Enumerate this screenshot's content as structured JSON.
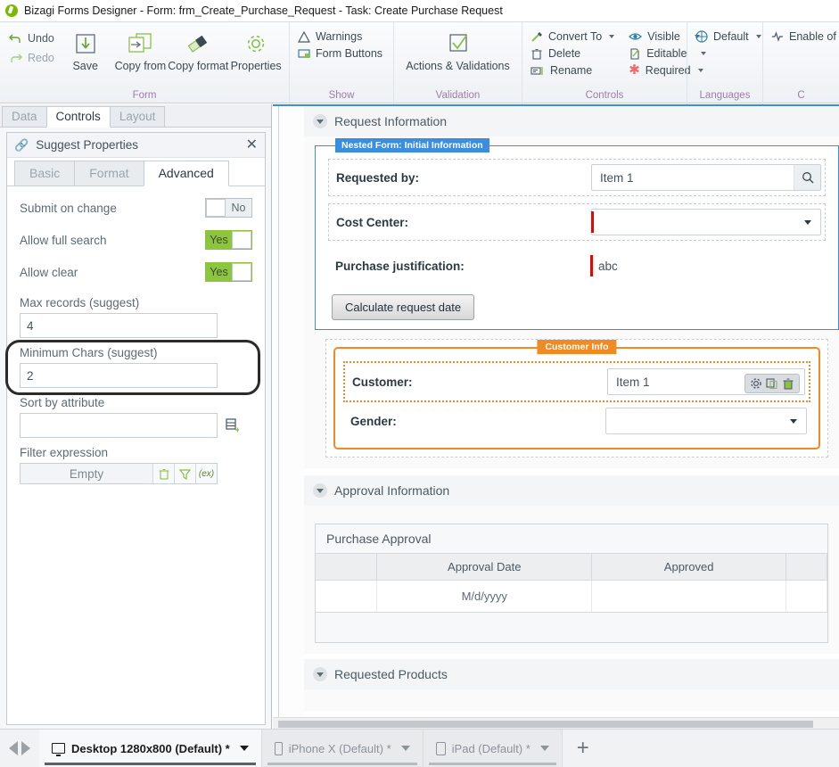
{
  "titlebar": {
    "app_name": "Bizagi Forms Designer",
    "full_title": "Bizagi Forms Designer  - Form: frm_Create_Purchase_Request - Task:  Create Purchase Request"
  },
  "ribbon": {
    "groups": [
      {
        "title": "Form",
        "small_commands": [
          {
            "label": "Undo",
            "icon": "undo-icon",
            "enabled": true
          },
          {
            "label": "Redo",
            "icon": "redo-icon",
            "enabled": false
          }
        ],
        "buttons": [
          {
            "label": "Save",
            "icon": "save-icon"
          },
          {
            "label": "Copy from",
            "icon": "copy-from-icon"
          },
          {
            "label": "Copy format",
            "icon": "copy-format-icon"
          },
          {
            "label": "Properties",
            "icon": "gear-icon"
          }
        ]
      },
      {
        "title": "Show",
        "items": [
          {
            "label": "Warnings",
            "icon": "warning-icon"
          },
          {
            "label": "Form Buttons",
            "icon": "form-buttons-icon"
          }
        ]
      },
      {
        "title": "Validation",
        "buttons": [
          {
            "label": "Actions & Validations",
            "icon": "checkmark-box-icon"
          }
        ]
      },
      {
        "title": "Controls",
        "items": [
          {
            "label": "Convert To",
            "icon": "convert-to-icon",
            "caret": true
          },
          {
            "label": "Delete",
            "icon": "trash-icon",
            "caret": false
          },
          {
            "label": "Rename",
            "icon": "rename-icon",
            "caret": false
          }
        ],
        "items2": [
          {
            "label": "Visible",
            "icon": "eye-icon",
            "caret": true
          },
          {
            "label": "Editable",
            "icon": "editable-icon",
            "caret": true
          },
          {
            "label": "Required",
            "icon": "asterisk-icon",
            "caret": true
          }
        ]
      },
      {
        "title": "Languages",
        "items": [
          {
            "label": "Default",
            "icon": "globe-icon",
            "caret": true
          }
        ]
      },
      {
        "title": "C",
        "items": [
          {
            "label": "Enable of",
            "icon": "enable-icon",
            "caret": false
          }
        ]
      }
    ]
  },
  "left_panel": {
    "tabs": [
      {
        "label": "Data",
        "active": false
      },
      {
        "label": "Controls",
        "active": true
      },
      {
        "label": "Layout",
        "active": false
      }
    ],
    "properties": {
      "header": "Suggest Properties",
      "header_icon": "link-icon",
      "close_icon": "close-icon",
      "tabs": [
        {
          "label": "Basic",
          "active": false
        },
        {
          "label": "Format",
          "active": false
        },
        {
          "label": "Advanced",
          "active": true
        }
      ],
      "toggles": [
        {
          "label": "Submit on change",
          "value": "No",
          "on": false
        },
        {
          "label": "Allow full search",
          "value": "Yes",
          "on": true
        },
        {
          "label": "Allow clear",
          "value": "Yes",
          "on": true
        }
      ],
      "fields": [
        {
          "label": "Max records (suggest)",
          "value": "4"
        },
        {
          "label": "Minimum Chars (suggest)",
          "value": "2"
        },
        {
          "label": "Sort by attribute",
          "value": "",
          "trailing_icon": "database-add-icon"
        }
      ],
      "filter": {
        "label": "Filter expression",
        "value": "Empty",
        "buttons": [
          {
            "icon": "trash-icon"
          },
          {
            "icon": "funnel-icon"
          },
          {
            "icon": "expression-icon",
            "text": "(ex)"
          }
        ]
      }
    }
  },
  "canvas": {
    "sections": [
      {
        "title": "Request Information"
      },
      {
        "title": "Approval Information"
      },
      {
        "title": "Requested Products"
      }
    ],
    "nested_form": {
      "tag": "Nested Form: Initial Information",
      "rows": [
        {
          "label": "Requested by:",
          "value": "Item 1",
          "control": "suggest",
          "required": false,
          "icon": "search-icon"
        },
        {
          "label": "Cost Center:",
          "value": "",
          "control": "dropdown",
          "required": true
        },
        {
          "label": "Purchase justification:",
          "value": "abc",
          "control": "text",
          "required": true
        }
      ],
      "button": "Calculate request date"
    },
    "customer_info": {
      "tag": "Customer Info",
      "rows": [
        {
          "label": "Customer:",
          "value": "Item 1",
          "control": "suggest",
          "selected": true
        },
        {
          "label": "Gender:",
          "value": "",
          "control": "dropdown",
          "selected": false
        }
      ],
      "toolbar_icons": [
        "gear-icon",
        "duplicate-icon",
        "trash-icon"
      ]
    },
    "approval_grid": {
      "title": "Purchase Approval",
      "columns": [
        "",
        "Approval Date",
        "Approved",
        ""
      ],
      "rows": [
        [
          "",
          "M/d/yyyy",
          "",
          ""
        ]
      ]
    }
  },
  "bottom_bar": {
    "nav": {
      "prev_icon": "arrow-left-icon",
      "next_icon": "arrow-right-icon"
    },
    "tabs": [
      {
        "label": "Desktop 1280x800 (Default) *",
        "icon": "monitor-icon",
        "active": true
      },
      {
        "label": "iPhone X (Default) *",
        "icon": "phone-icon",
        "active": false
      },
      {
        "label": "iPad (Default) *",
        "icon": "tablet-icon",
        "active": false
      }
    ],
    "add_label": "+"
  },
  "colors": {
    "brand_green": "#7ab800",
    "toggle_on": "#8cc63f",
    "nested_blue": "#3b8de0",
    "group_orange": "#ef8b22",
    "required_red": "#f20000",
    "group_title": "#9d7fa5"
  }
}
